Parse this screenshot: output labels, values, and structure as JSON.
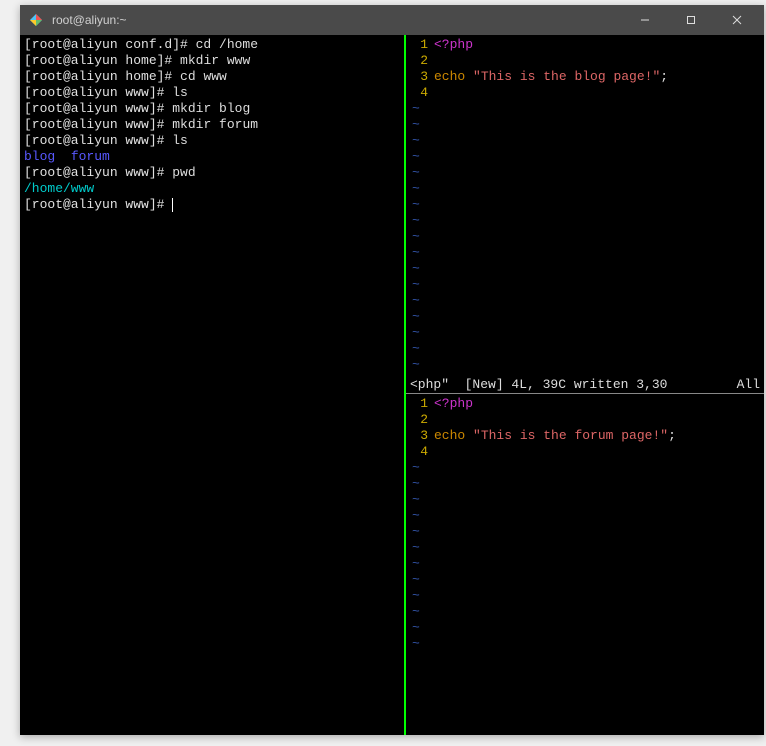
{
  "window": {
    "title": "root@aliyun:~"
  },
  "terminal": {
    "lines": [
      {
        "type": "cmd",
        "prompt": "[root@aliyun conf.d]#",
        "cmd": " cd /home"
      },
      {
        "type": "cmd",
        "prompt": "[root@aliyun home]#",
        "cmd": " mkdir www"
      },
      {
        "type": "cmd",
        "prompt": "[root@aliyun home]#",
        "cmd": " cd www"
      },
      {
        "type": "cmd",
        "prompt": "[root@aliyun www]#",
        "cmd": " ls"
      },
      {
        "type": "cmd",
        "prompt": "[root@aliyun www]#",
        "cmd": " mkdir blog"
      },
      {
        "type": "cmd",
        "prompt": "[root@aliyun www]#",
        "cmd": " mkdir forum"
      },
      {
        "type": "cmd",
        "prompt": "[root@aliyun www]#",
        "cmd": " ls"
      },
      {
        "type": "dirs",
        "items": [
          "blog",
          "forum"
        ]
      },
      {
        "type": "cmd",
        "prompt": "[root@aliyun www]#",
        "cmd": " pwd"
      },
      {
        "type": "path",
        "text": "/home/www"
      },
      {
        "type": "cmd_cursor",
        "prompt": "[root@aliyun www]#",
        "cmd": " "
      }
    ]
  },
  "editor_top": {
    "lines": [
      {
        "n": "1",
        "tokens": [
          {
            "cls": "php-tag",
            "t": "<?php"
          }
        ]
      },
      {
        "n": "2",
        "tokens": []
      },
      {
        "n": "3",
        "tokens": [
          {
            "cls": "keyword",
            "t": "echo"
          },
          {
            "cls": "plain",
            "t": " "
          },
          {
            "cls": "string",
            "t": "\"This is the blog page!\""
          },
          {
            "cls": "plain",
            "t": ";"
          }
        ]
      },
      {
        "n": "4",
        "tokens": []
      }
    ],
    "tildes": 17
  },
  "status": {
    "left": "<php\"  [New] 4L, 39C written 3,30",
    "right": "All"
  },
  "editor_bottom": {
    "lines": [
      {
        "n": "1",
        "tokens": [
          {
            "cls": "php-tag",
            "t": "<?php"
          }
        ]
      },
      {
        "n": "2",
        "tokens": []
      },
      {
        "n": "3",
        "tokens": [
          {
            "cls": "keyword",
            "t": "echo"
          },
          {
            "cls": "plain",
            "t": " "
          },
          {
            "cls": "string",
            "t": "\"This is the forum page!\""
          },
          {
            "cls": "plain",
            "t": ";"
          }
        ]
      },
      {
        "n": "4",
        "tokens": []
      }
    ],
    "tildes": 12
  }
}
